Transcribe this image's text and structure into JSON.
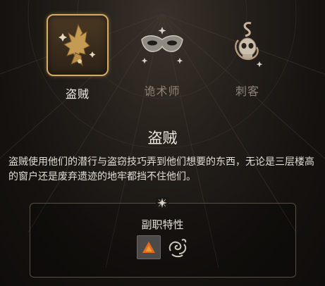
{
  "subclasses": [
    {
      "label": "盗贼",
      "icon": "thief-rogue-icon",
      "selected": true
    },
    {
      "label": "诡术师",
      "icon": "arcane-trickster-mask-icon",
      "selected": false
    },
    {
      "label": "刺客",
      "icon": "assassin-skull-snake-icon",
      "selected": false
    }
  ],
  "selected": {
    "title": "盗贼",
    "description": "盗贼使用他们的潜行与盗窃技巧弄到他们想要的东西，无论是三层楼高的窗户还是废弃遗迹的地牢都挡不住他们。"
  },
  "traits": {
    "heading": "副职特性",
    "icons": [
      "fast-hands-fire-icon",
      "smoke-swirl-icon"
    ]
  },
  "colors": {
    "accent": "#d3ad63",
    "text": "#ece6de",
    "muted": "#8e8478"
  }
}
